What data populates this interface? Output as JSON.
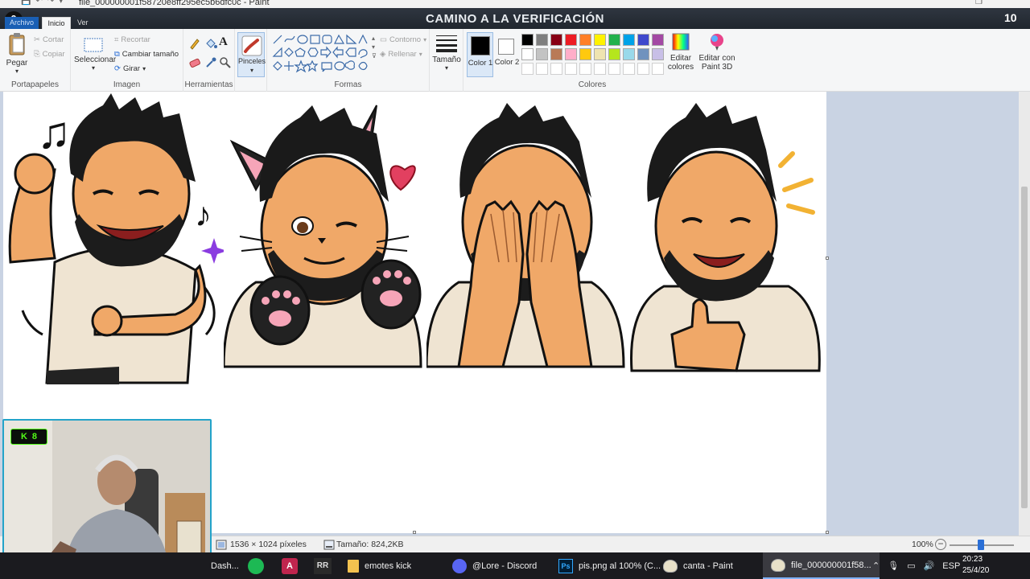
{
  "window": {
    "title": "file_000000001f58720e8ff295ec5b6dfc0c - Paint",
    "quick_access": [
      "💾",
      "↶",
      "↷",
      "▾"
    ],
    "maximize_glyph": "❐"
  },
  "overlay": {
    "banner": "CAMINO A LA VERIFICACIÓN",
    "counter_left": "0",
    "counter_right": "10"
  },
  "ribbon_tabs": {
    "file": "Archivo",
    "home": "Inicio",
    "view": "Ver"
  },
  "ribbon": {
    "clipboard": {
      "paste": "Pegar",
      "cut": "Cortar",
      "copy": "Copiar",
      "label": "Portapapeles"
    },
    "image": {
      "select": "Seleccionar",
      "crop": "Recortar",
      "resize": "Cambiar tamaño",
      "rotate": "Girar",
      "label": "Imagen"
    },
    "tools": {
      "label": "Herramientas"
    },
    "brushes": {
      "label": "Pinceles"
    },
    "shapes": {
      "outline": "Contorno",
      "fill": "Rellenar",
      "label": "Formas"
    },
    "size": {
      "label": "Tamaño"
    },
    "color1": {
      "label": "Color 1",
      "value": "#000000"
    },
    "color2": {
      "label": "Color 2",
      "value": "#ffffff"
    },
    "colors": {
      "label": "Colores",
      "edit": "Editar colores",
      "paint3d": "Editar con Paint 3D",
      "palette_row1": [
        "#000000",
        "#7f7f7f",
        "#880015",
        "#ed1c24",
        "#ff7f27",
        "#fff200",
        "#22b14c",
        "#00a2e8",
        "#3f48cc",
        "#a349a4"
      ],
      "palette_row2": [
        "#ffffff",
        "#c3c3c3",
        "#b97a57",
        "#ffaec9",
        "#ffc90e",
        "#efe4b0",
        "#b5e61d",
        "#99d9ea",
        "#7092be",
        "#c8bfe7"
      ]
    }
  },
  "status": {
    "dimensions": "1536 × 1024 píxeles",
    "file_size": "Tamaño: 824,2KB",
    "zoom": "100%"
  },
  "webcam": {
    "kick_badge": "8"
  },
  "taskbar": {
    "items": [
      {
        "label": "Dash..."
      },
      {
        "label": "emotes kick"
      },
      {
        "label": "@Lore - Discord"
      },
      {
        "label": "pis.png al 100% (C..."
      },
      {
        "label": "canta - Paint"
      },
      {
        "label": "file_000000001f58..."
      }
    ],
    "lang": "ESP",
    "time": "20:23",
    "date": "25/4/20"
  }
}
